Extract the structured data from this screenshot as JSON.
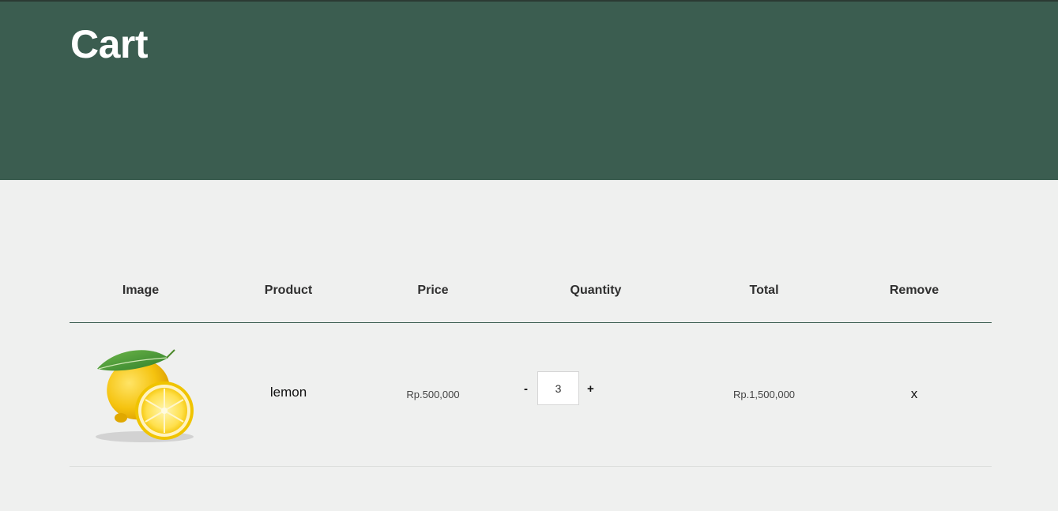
{
  "page": {
    "title": "Cart"
  },
  "colors": {
    "hero_bg": "#3b5d50",
    "page_bg": "#eff0ef",
    "accent_rule": "#3b5d50"
  },
  "table": {
    "headers": [
      "Image",
      "Product",
      "Price",
      "Quantity",
      "Total",
      "Remove"
    ],
    "rows": [
      {
        "image_icon": "lemon-product-image",
        "product": "lemon",
        "price": "Rp.500,000",
        "quantity": "3",
        "decrease_label": "-",
        "increase_label": "+",
        "total": "Rp.1,500,000",
        "remove_label": "x"
      }
    ]
  }
}
